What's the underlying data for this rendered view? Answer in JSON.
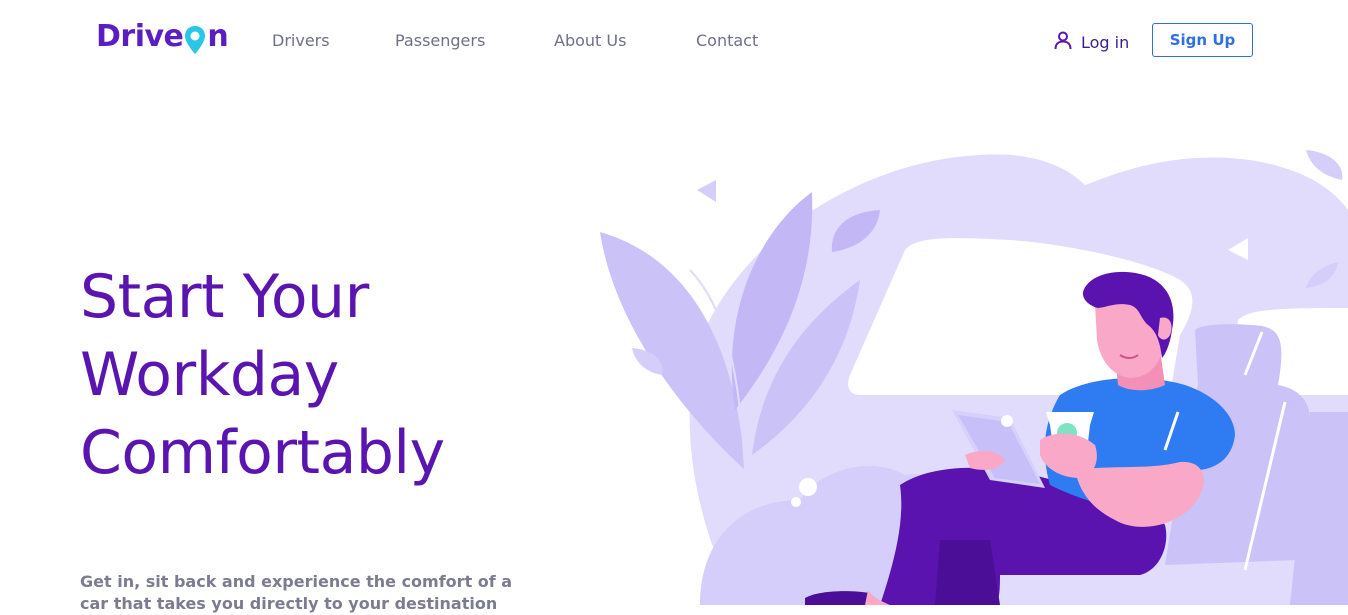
{
  "header": {
    "logo": {
      "part1": "Drive",
      "part2": "n"
    },
    "nav": [
      {
        "label": "Drivers"
      },
      {
        "label": "Passengers"
      },
      {
        "label": "About Us"
      },
      {
        "label": "Contact"
      }
    ],
    "login_label": "Log in",
    "signup_label": "Sign Up"
  },
  "hero": {
    "title_lines": [
      "Start Your",
      "Workday",
      "Comfortably"
    ],
    "text": "Get in, sit back and experience the comfort of a car that takes you directly to your destination"
  },
  "icons": {
    "logo_pin": "location-pin-icon",
    "login": "user-icon"
  },
  "colors": {
    "brand_purple": "#5a15b0",
    "nav_text": "#6f6f88",
    "signup_blue": "#2f6fe4",
    "pin_cyan": "#29c6e8",
    "illustration_lavender": "#e1dcfb",
    "shirt_blue": "#2f7bf2",
    "skin_pink": "#f9a8c8"
  }
}
